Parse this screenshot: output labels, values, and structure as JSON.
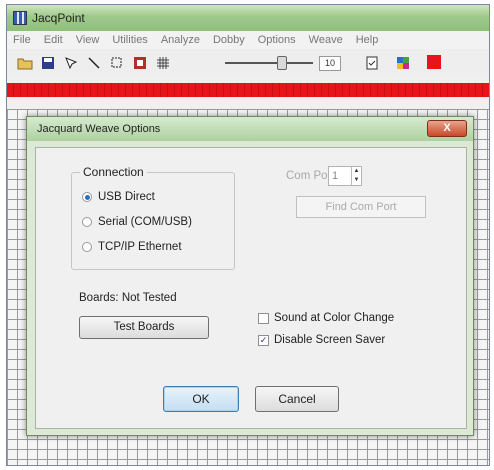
{
  "app": {
    "title": "JacqPoint",
    "icon": "jacqpoint-app-icon"
  },
  "menu": {
    "items": [
      "File",
      "Edit",
      "View",
      "Utilities",
      "Analyze",
      "Dobby",
      "Options",
      "Weave",
      "Help"
    ]
  },
  "toolbar": {
    "icons": [
      "open-folder-icon",
      "save-icon",
      "pointer-icon",
      "line-icon",
      "select-icon",
      "pattern-icon",
      "grid-icon"
    ],
    "zoom_value": "10",
    "right_icons": [
      "document-icon",
      "palette-icon",
      "stop-color-icon"
    ],
    "stop_color": "#e8141a"
  },
  "colors": {
    "color_bar": "#e8141a",
    "title_green": "#9fc98a",
    "close_red": "#c8482a"
  },
  "dialog": {
    "title": "Jacquard Weave Options",
    "close_label": "X",
    "connection": {
      "legend": "Connection",
      "options": [
        {
          "label": "USB Direct",
          "selected": true
        },
        {
          "label": "Serial (COM/USB)",
          "selected": false
        },
        {
          "label": "TCP/IP Ethernet",
          "selected": false
        }
      ]
    },
    "com_port": {
      "label": "Com Port:",
      "value": "1",
      "enabled": false
    },
    "find_com_port_label": "Find Com Port",
    "boards_status": "Boards: Not Tested",
    "test_boards_label": "Test Boards",
    "checkboxes": [
      {
        "label": "Sound at Color Change",
        "checked": false
      },
      {
        "label": "Disable Screen Saver",
        "checked": true
      }
    ],
    "ok_label": "OK",
    "cancel_label": "Cancel"
  }
}
